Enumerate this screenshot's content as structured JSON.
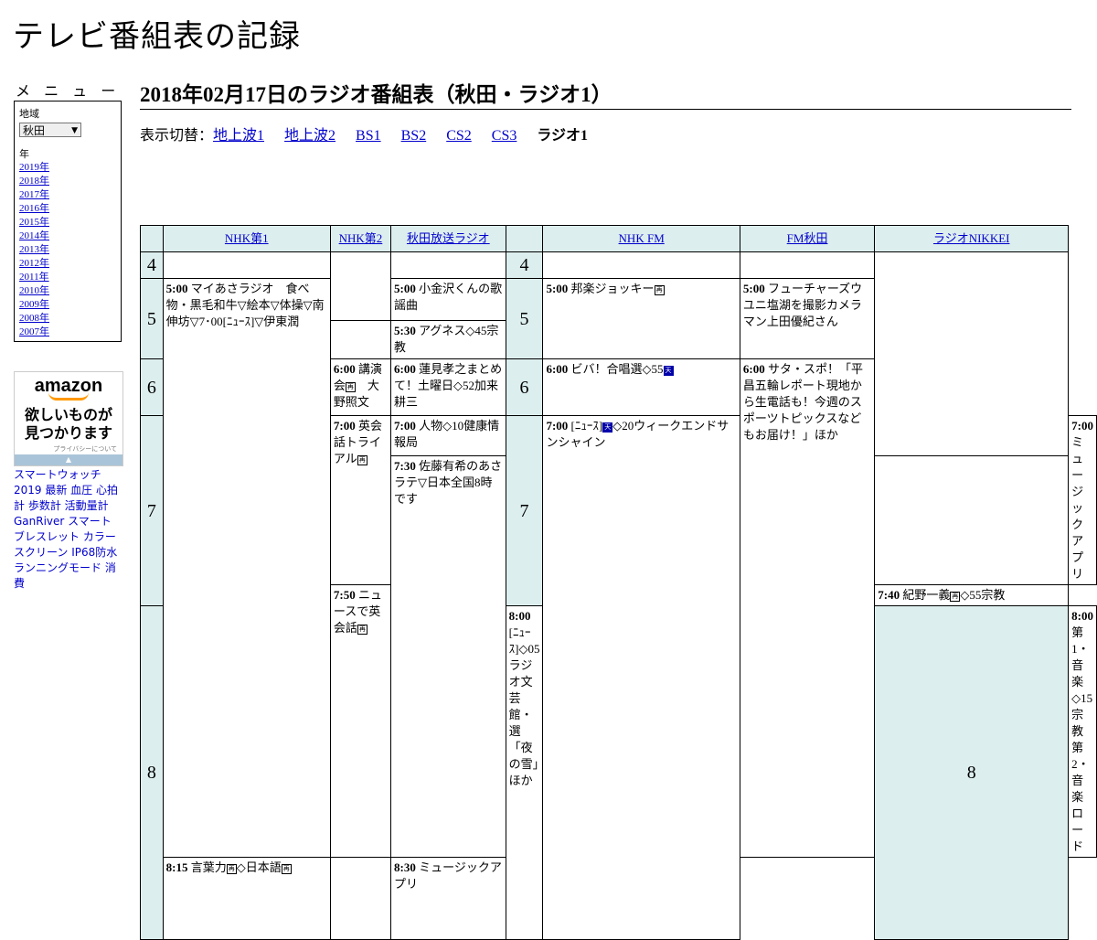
{
  "site": {
    "title": "テレビ番組表の記録"
  },
  "menu": {
    "heading": "メ ニ ュ ー",
    "region_label": "地域",
    "region_value": "秋田",
    "year_label": "年",
    "years": [
      "2019年",
      "2018年",
      "2017年",
      "2016年",
      "2015年",
      "2014年",
      "2013年",
      "2012年",
      "2011年",
      "2010年",
      "2009年",
      "2008年",
      "2007年"
    ]
  },
  "ad": {
    "logo": "amazon",
    "copy1": "欲しいものが",
    "copy2": "見つかります",
    "privacy": "プライバシーについて",
    "bar_arrow": "▲",
    "text": "スマートウォッチ 2019 最新 血圧 心拍計 歩数計 活動量計 GanRiver スマートブレスレット カラースクリーン IP68防水 ランニングモード 消費"
  },
  "page": {
    "title": "2018年02月17日のラジオ番組表（秋田・ラジオ1）",
    "switch_label": "表示切替：",
    "switch_links": [
      "地上波1",
      "地上波2",
      "BS1",
      "BS2",
      "CS2",
      "CS3"
    ],
    "switch_current": "ラジオ1"
  },
  "channels": [
    "NHK第1",
    "NHK第2",
    "秋田放送ラジオ",
    "NHK FM",
    "FM秋田",
    "ラジオNIKKEI"
  ],
  "hours": [
    "4",
    "5",
    "6",
    "7",
    "8"
  ],
  "programs": {
    "nhk1_5": {
      "time": "5:00",
      "title": "マイあさラジオ　食べ物・黒毛和牛▽絵本▽体操▽南伸坊▽7･00[ﾆｭｰｽ]▽伊東潤"
    },
    "nhk1_8": {
      "time": "8:00",
      "title": "[ﾆｭｰｽ]◇05ラジオ文芸館・選「夜の雪」ほか"
    },
    "nhk2_6": {
      "time": "6:00",
      "title": "講演会",
      "tail": "　大野照文"
    },
    "nhk2_7": {
      "time": "7:00",
      "title": "英会話トライアル"
    },
    "nhk2_750": {
      "time": "7:50",
      "title": "ニュースで英会話"
    },
    "nhk2_815": {
      "time": "8:15",
      "title": "言葉力",
      "tail": "◇日本語"
    },
    "abs_5": {
      "time": "5:00",
      "title": "小金沢くんの歌謡曲"
    },
    "abs_530": {
      "time": "5:30",
      "title": "アグネス◇45宗教"
    },
    "abs_6": {
      "time": "6:00",
      "title": "蓮見孝之まとめて！土曜日◇52加来耕三"
    },
    "abs_7": {
      "time": "7:00",
      "title": "人物◇10健康情報局"
    },
    "abs_730": {
      "time": "7:30",
      "title": "佐藤有希のあさラテ▽日本全国8時です"
    },
    "fm_5": {
      "time": "5:00",
      "title": "邦楽ジョッキー"
    },
    "fm_6": {
      "time": "6:00",
      "title": "ビバ！合唱選◇55"
    },
    "fm_7": {
      "time": "7:00",
      "title": "[ﾆｭｰｽ]",
      "tail": "◇20ウィークエンドサンシャイン"
    },
    "fma_5": {
      "time": "5:00",
      "title": "フューチャーズウユニ塩湖を撮影カメラマン上田優紀さん"
    },
    "fma_6": {
      "time": "6:00",
      "title": "サタ・スポ！「平昌五輪レポート現地から生電話も！今週のスポーツトピックスなどもお届け！」ほか"
    },
    "nk_7": {
      "time": "7:00",
      "title": "ミュージックアプリ"
    },
    "nk_740": {
      "time": "7:40",
      "title": "紀野一義",
      "tail": "◇55宗教"
    },
    "nk_8": {
      "time": "8:00",
      "title": "第1・音楽◇15宗教第2・音楽ロード"
    },
    "nk_830": {
      "time": "8:30",
      "title": "ミュージックアプリ"
    }
  },
  "marks": {
    "rebroadcast": "再",
    "weather": "天"
  }
}
